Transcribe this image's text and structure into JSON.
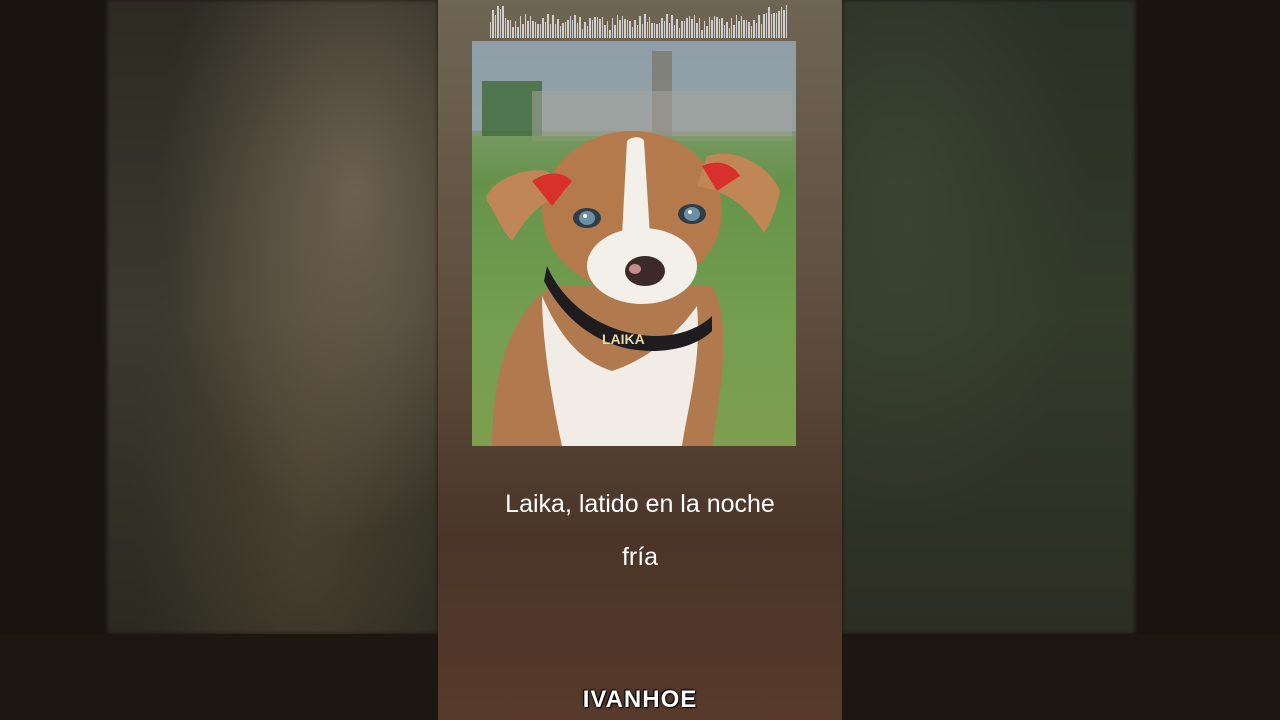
{
  "lyrics": {
    "line1": "Laika, latido en la noche",
    "line2": "fría"
  },
  "brand": "IVANHOE",
  "collar_text": "LAIKA",
  "colors": {
    "card_top": "#6f6553",
    "card_bottom": "#573a2b",
    "text": "#ffffff"
  }
}
